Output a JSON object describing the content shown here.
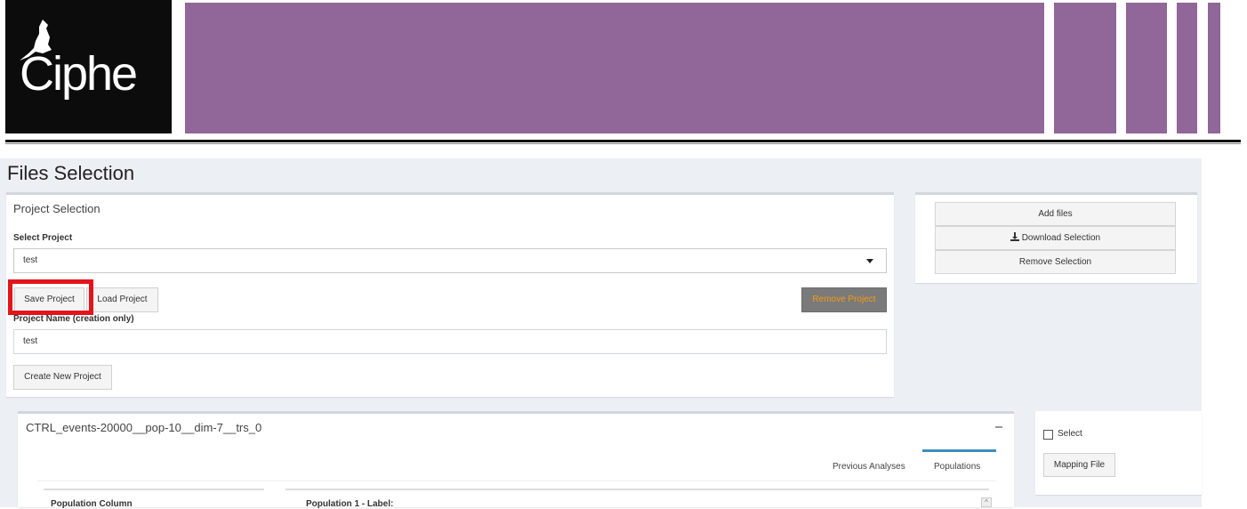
{
  "header": {
    "logo_text": "Ciphe",
    "brand_color": "#916699"
  },
  "page": {
    "title": "Files Selection"
  },
  "project_selection": {
    "title": "Project Selection",
    "select_label": "Select Project",
    "selected_project": "test",
    "save_button": "Save Project",
    "load_button": "Load Project",
    "remove_button": "Remove Project",
    "name_label": "Project Name (creation only)",
    "name_value": "test",
    "create_button": "Create New Project"
  },
  "file_actions": {
    "add_files": "Add files",
    "download_selection": "Download Selection",
    "remove_selection": "Remove Selection"
  },
  "file_panel": {
    "title": "CTRL_events-20000__pop-10__dim-7__trs_0",
    "tabs": [
      "Previous Analyses",
      "Populations"
    ],
    "active_tab": "Populations",
    "population_column_label": "Population Column",
    "population_label": "Population 1 - Label:"
  },
  "side_panel": {
    "select_label": "Select",
    "mapping_button": "Mapping File"
  },
  "icons": [
    "mouse-logo-icon",
    "download-icon",
    "caret-down-icon",
    "collapse-icon",
    "checkbox-icon",
    "scroll-up-icon"
  ]
}
